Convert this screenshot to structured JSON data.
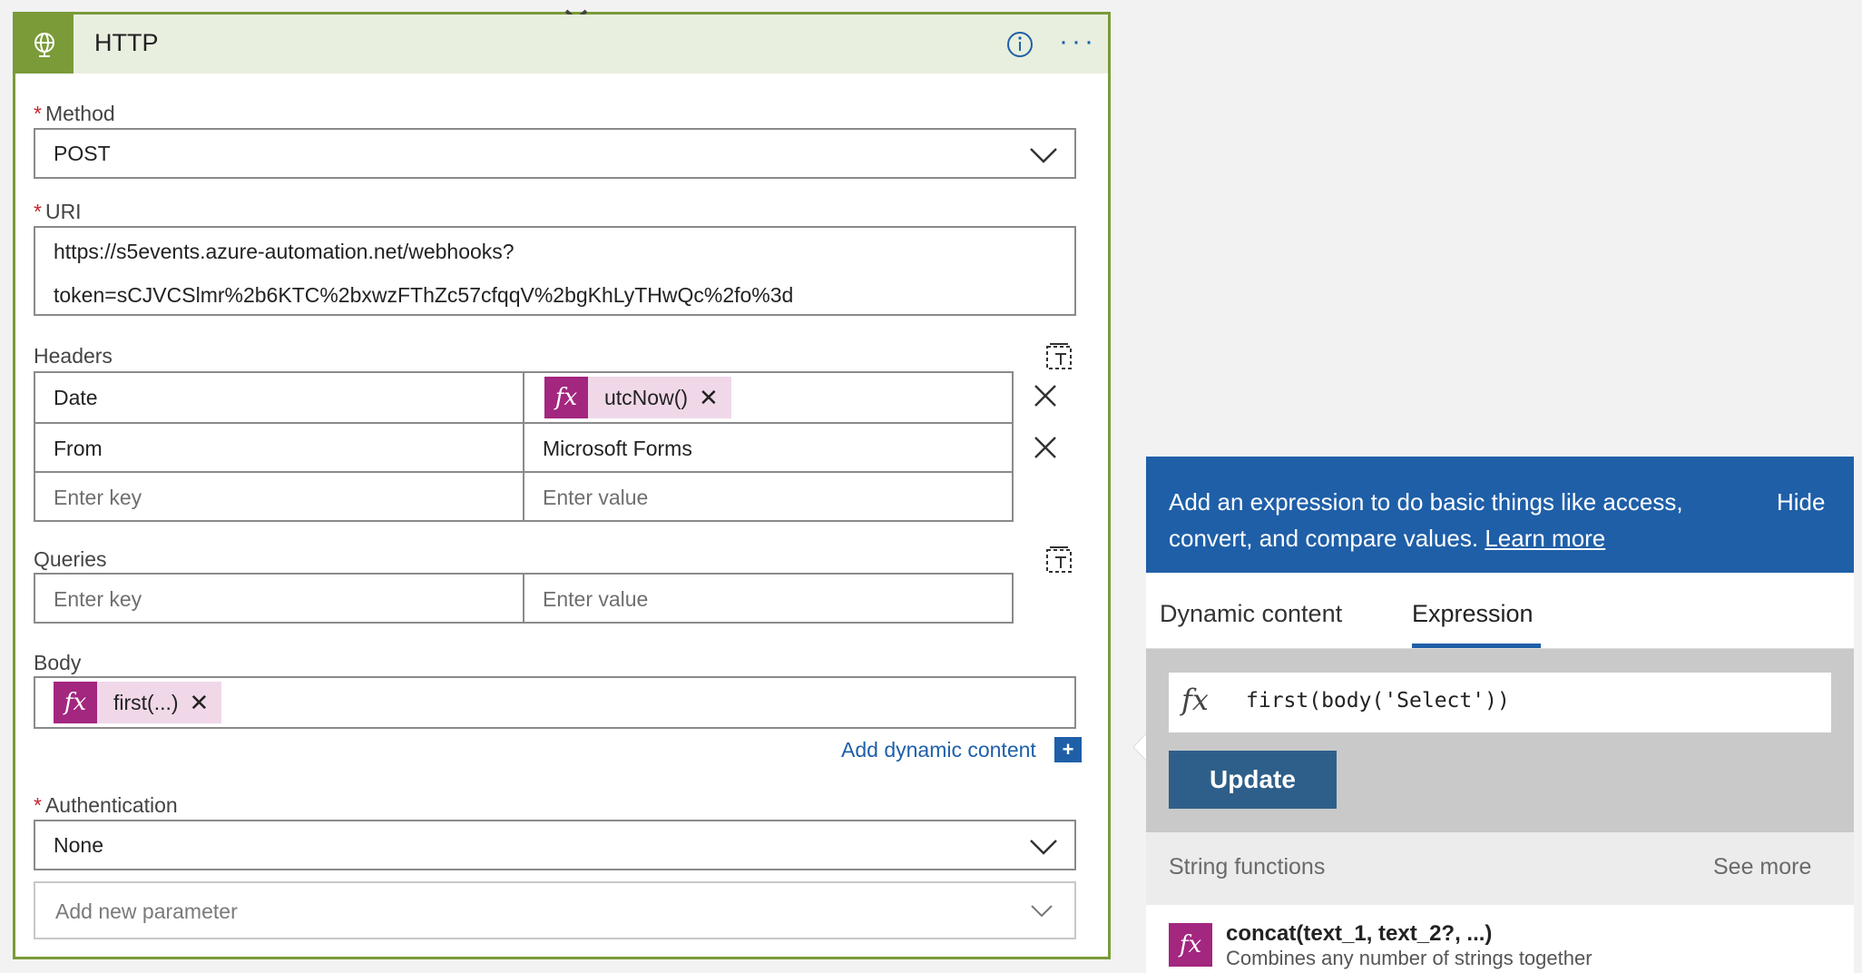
{
  "card": {
    "title": "HTTP",
    "info_icon": "info-icon",
    "more_icon": "more-options-icon",
    "method": {
      "label": "Method",
      "value": "POST"
    },
    "uri": {
      "label": "URI",
      "line1": "https://s5events.azure-automation.net/webhooks?",
      "line2": "token=sCJVCSlmr%2b6KTC%2bxwzFThZc57cfqqV%2bgKhLyTHwQc%2fo%3d"
    },
    "headers": {
      "label": "Headers",
      "rows": [
        {
          "key": "Date",
          "value_token": "utcNow()"
        },
        {
          "key": "From",
          "value": "Microsoft Forms"
        }
      ],
      "key_placeholder": "Enter key",
      "value_placeholder": "Enter value"
    },
    "queries": {
      "label": "Queries",
      "key_placeholder": "Enter key",
      "value_placeholder": "Enter value"
    },
    "body": {
      "label": "Body",
      "token": "first(...)"
    },
    "add_dynamic_content": "Add dynamic content",
    "authentication": {
      "label": "Authentication",
      "value": "None"
    },
    "add_new_parameter": "Add new parameter",
    "fx_symbol": "fx"
  },
  "panel": {
    "info_text_line1": "Add an expression to do basic things like access,",
    "info_text_line2": "convert, and compare values.",
    "learn_more": "Learn more",
    "hide": "Hide",
    "tabs": [
      {
        "label": "Dynamic content",
        "active": false
      },
      {
        "label": "Expression",
        "active": true
      }
    ],
    "expression_value": "first(body('Select'))",
    "update_button": "Update",
    "section_title": "String functions",
    "see_more": "See more",
    "functions": [
      {
        "name": "concat(text_1, text_2?, ...)",
        "description": "Combines any number of strings together"
      }
    ]
  },
  "colors": {
    "card_border": "#7a9b38",
    "header_bg": "#e8efdf",
    "accent_blue": "#1f5fa8",
    "token_purple": "#a3267f",
    "token_bg": "#f0d8e9",
    "update_button": "#2e5f8a"
  }
}
